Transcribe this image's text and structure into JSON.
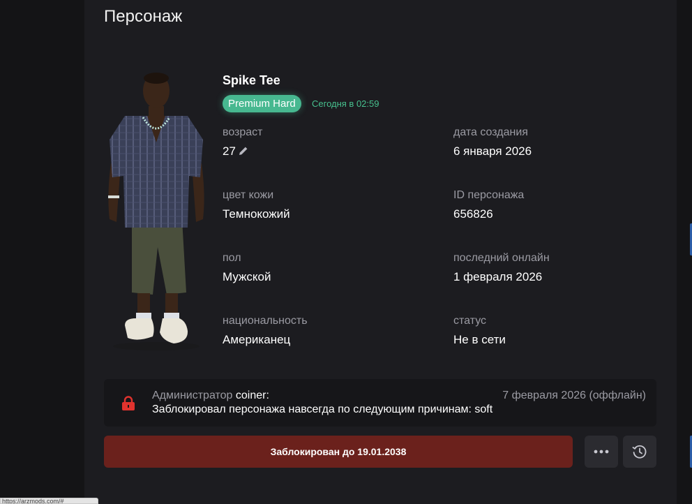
{
  "page": {
    "title": "Персонаж"
  },
  "character": {
    "name": "Spike Tee",
    "badge": "Premium Hard",
    "last_seen": "Сегодня в 02:59"
  },
  "fields": {
    "age": {
      "label": "возраст",
      "value": "27"
    },
    "created": {
      "label": "дата создания",
      "value": "6 января 2026"
    },
    "skin": {
      "label": "цвет кожи",
      "value": "Темнокожий"
    },
    "char_id": {
      "label": "ID персонажа",
      "value": "656826"
    },
    "gender": {
      "label": "пол",
      "value": "Мужской"
    },
    "last_online": {
      "label": "последний онлайн",
      "value": "1 февраля 2026"
    },
    "nationality": {
      "label": "национальность",
      "value": "Американец"
    },
    "status": {
      "label": "статус",
      "value": "Не в сети"
    }
  },
  "admin_note": {
    "role": "Администратор",
    "name": "coiner:",
    "date": "7 февраля 2026 (оффлайн)",
    "message": "Заблокировал персонажа навсегда по следующим причинам: soft"
  },
  "actions": {
    "blocked_label": "Заблокирован до 19.01.2038"
  },
  "browser": {
    "status_url": "https://arzmods.com/#"
  },
  "colors": {
    "background": "#141416",
    "card": "#1c1c20",
    "badge": "#47b890",
    "blocked": "#6b211c",
    "lock": "#e0332e"
  }
}
